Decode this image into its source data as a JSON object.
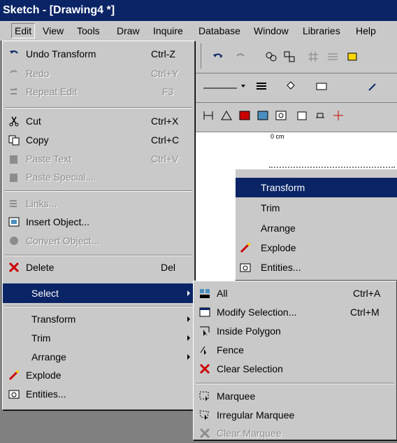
{
  "window": {
    "title": "Sketch - [Drawing4 *]"
  },
  "menubar": {
    "items": [
      "Edit",
      "View",
      "Tools",
      "Draw",
      "Inquire",
      "Database",
      "Window",
      "Libraries",
      "Help"
    ]
  },
  "ruler": {
    "label": "0 cm"
  },
  "edit_menu": {
    "undo": {
      "label": "Undo Transform",
      "shortcut": "Ctrl-Z"
    },
    "redo": {
      "label": "Redo",
      "shortcut": "Ctrl+Y"
    },
    "repeat": {
      "label": "Repeat Edit",
      "shortcut": "F3"
    },
    "cut": {
      "label": "Cut",
      "shortcut": "Ctrl+X"
    },
    "copy": {
      "label": "Copy",
      "shortcut": "Ctrl+C"
    },
    "paste_text": {
      "label": "Paste Text",
      "shortcut": "Ctrl+V"
    },
    "paste_special": {
      "label": "Paste Special..."
    },
    "links": {
      "label": "Links..."
    },
    "insert_object": {
      "label": "Insert Object..."
    },
    "convert_object": {
      "label": "Convert Object..."
    },
    "delete": {
      "label": "Delete",
      "shortcut": "Del"
    },
    "select": {
      "label": "Select"
    },
    "transform": {
      "label": "Transform"
    },
    "trim": {
      "label": "Trim"
    },
    "arrange": {
      "label": "Arrange"
    },
    "explode": {
      "label": "Explode"
    },
    "entities": {
      "label": "Entities..."
    }
  },
  "context_menu": {
    "transform": {
      "label": "Transform"
    },
    "trim": {
      "label": "Trim"
    },
    "arrange": {
      "label": "Arrange"
    },
    "explode": {
      "label": "Explode"
    },
    "entities": {
      "label": "Entities..."
    }
  },
  "select_submenu": {
    "all": {
      "label": "All",
      "shortcut": "Ctrl+A"
    },
    "modify": {
      "label": "Modify Selection...",
      "shortcut": "Ctrl+M"
    },
    "inside_polygon": {
      "label": "Inside Polygon"
    },
    "fence": {
      "label": "Fence"
    },
    "clear_selection": {
      "label": "Clear Selection"
    },
    "marquee": {
      "label": "Marquee"
    },
    "irregular_marquee": {
      "label": "Irregular Marquee"
    },
    "clear_marquee": {
      "label": "Clear Marquee"
    }
  },
  "colors": {
    "highlight": "#0a2466",
    "menu_bg": "#c9c9c9",
    "disabled": "#8c8c8c"
  }
}
